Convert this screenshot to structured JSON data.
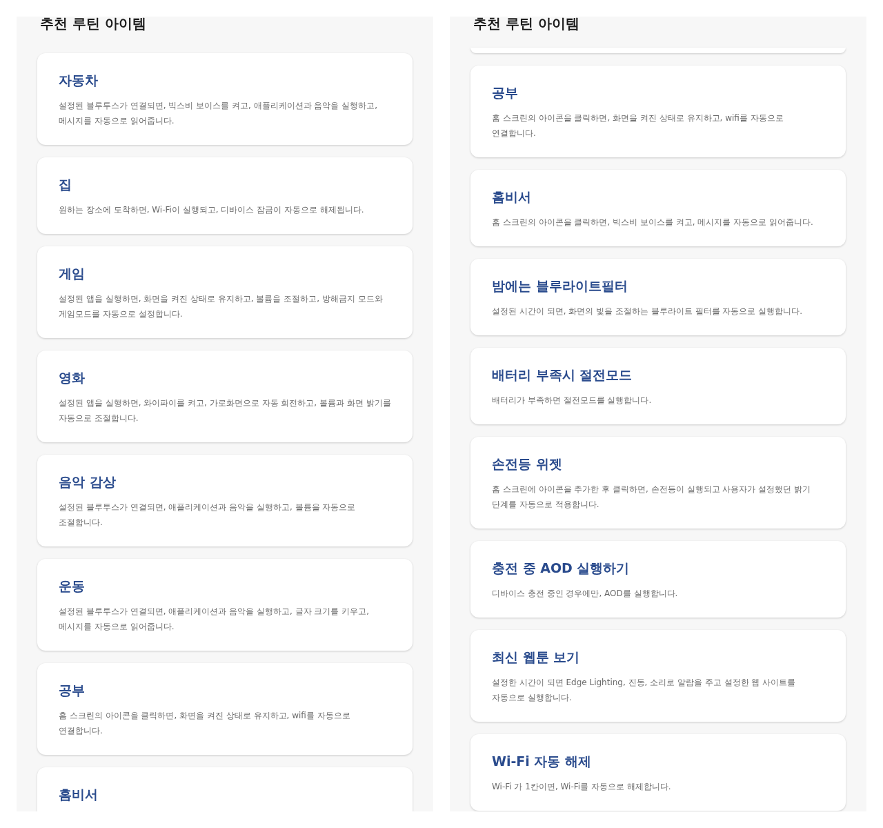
{
  "panels": [
    {
      "heading": "추천 루틴 아이템",
      "partial_card_above": false,
      "cards": [
        {
          "title": "자동차",
          "description": "설정된 블루투스가 연결되면, 빅스비 보이스를 켜고, 애플리케이션과 음악을 실행하고, 메시지를 자동으로 읽어줍니다."
        },
        {
          "title": "집",
          "description": "원하는 장소에 도착하면, Wi-Fi이 실행되고, 디바이스 잠금이 자동으로 해제됩니다."
        },
        {
          "title": "게임",
          "description": "설정된 앱을 실행하면, 화면을 켜진 상태로 유지하고, 볼륨을 조절하고, 방해금지 모드와 게임모드를 자동으로 설정합니다."
        },
        {
          "title": "영화",
          "description": "설정된 앱을 실행하면, 와이파이를 켜고, 가로화면으로 자동 회전하고, 볼륨과 화면 밝기를 자동으로 조절합니다."
        },
        {
          "title": "음악 감상",
          "description": "설정된 블루투스가 연결되면, 애플리케이션과 음악을 실행하고, 볼륨을 자동으로 조절합니다."
        },
        {
          "title": "운동",
          "description": "설정된 블루투스가 연결되면, 애플리케이션과 음악을 실행하고, 글자 크기를 키우고, 메시지를 자동으로 읽어줍니다."
        },
        {
          "title": "공부",
          "description": "홈 스크린의 아이콘을 클릭하면, 화면을 켜진 상태로 유지하고, wifi를 자동으로 연결합니다."
        },
        {
          "title": "홈비서"
        }
      ]
    },
    {
      "heading": "추천 루틴 아이템",
      "partial_card_above": true,
      "cards": [
        {
          "title": "공부",
          "description": "홈 스크린의 아이콘을 클릭하면, 화면을 켜진 상태로 유지하고, wifi를 자동으로 연결합니다."
        },
        {
          "title": "홈비서",
          "description": "홈 스크린의 아이콘을 클릭하면, 빅스비 보이스를 켜고, 메시지를 자동으로 읽어줍니다."
        },
        {
          "title": "밤에는 블루라이트필터",
          "description": "설정된 시간이 되면, 화면의 빛을 조절하는 블루라이트 필터를 자동으로 실행합니다."
        },
        {
          "title": "배터리 부족시 절전모드",
          "description": "배터리가 부족하면 절전모드를 실행합니다."
        },
        {
          "title": "손전등 위젯",
          "description": "홈 스크린에 아이콘을 추가한 후 클릭하면, 손전등이 실행되고 사용자가 설정했던 밝기 단계를 자동으로 적용합니다."
        },
        {
          "title": "충전 중 AOD 실행하기",
          "description": "디바이스 충전 중인 경우에만, AOD를 실행합니다."
        },
        {
          "title": "최신 웹툰 보기",
          "description": "설정한 시간이 되면 Edge Lighting, 진동, 소리로 알람을 주고 설정한 웹 사이트를 자동으로 실행합니다."
        },
        {
          "title": "Wi-Fi 자동 해제",
          "description": "Wi-Fi 가 1칸이면, Wi-Fi를 자동으로 해제합니다."
        }
      ]
    }
  ]
}
